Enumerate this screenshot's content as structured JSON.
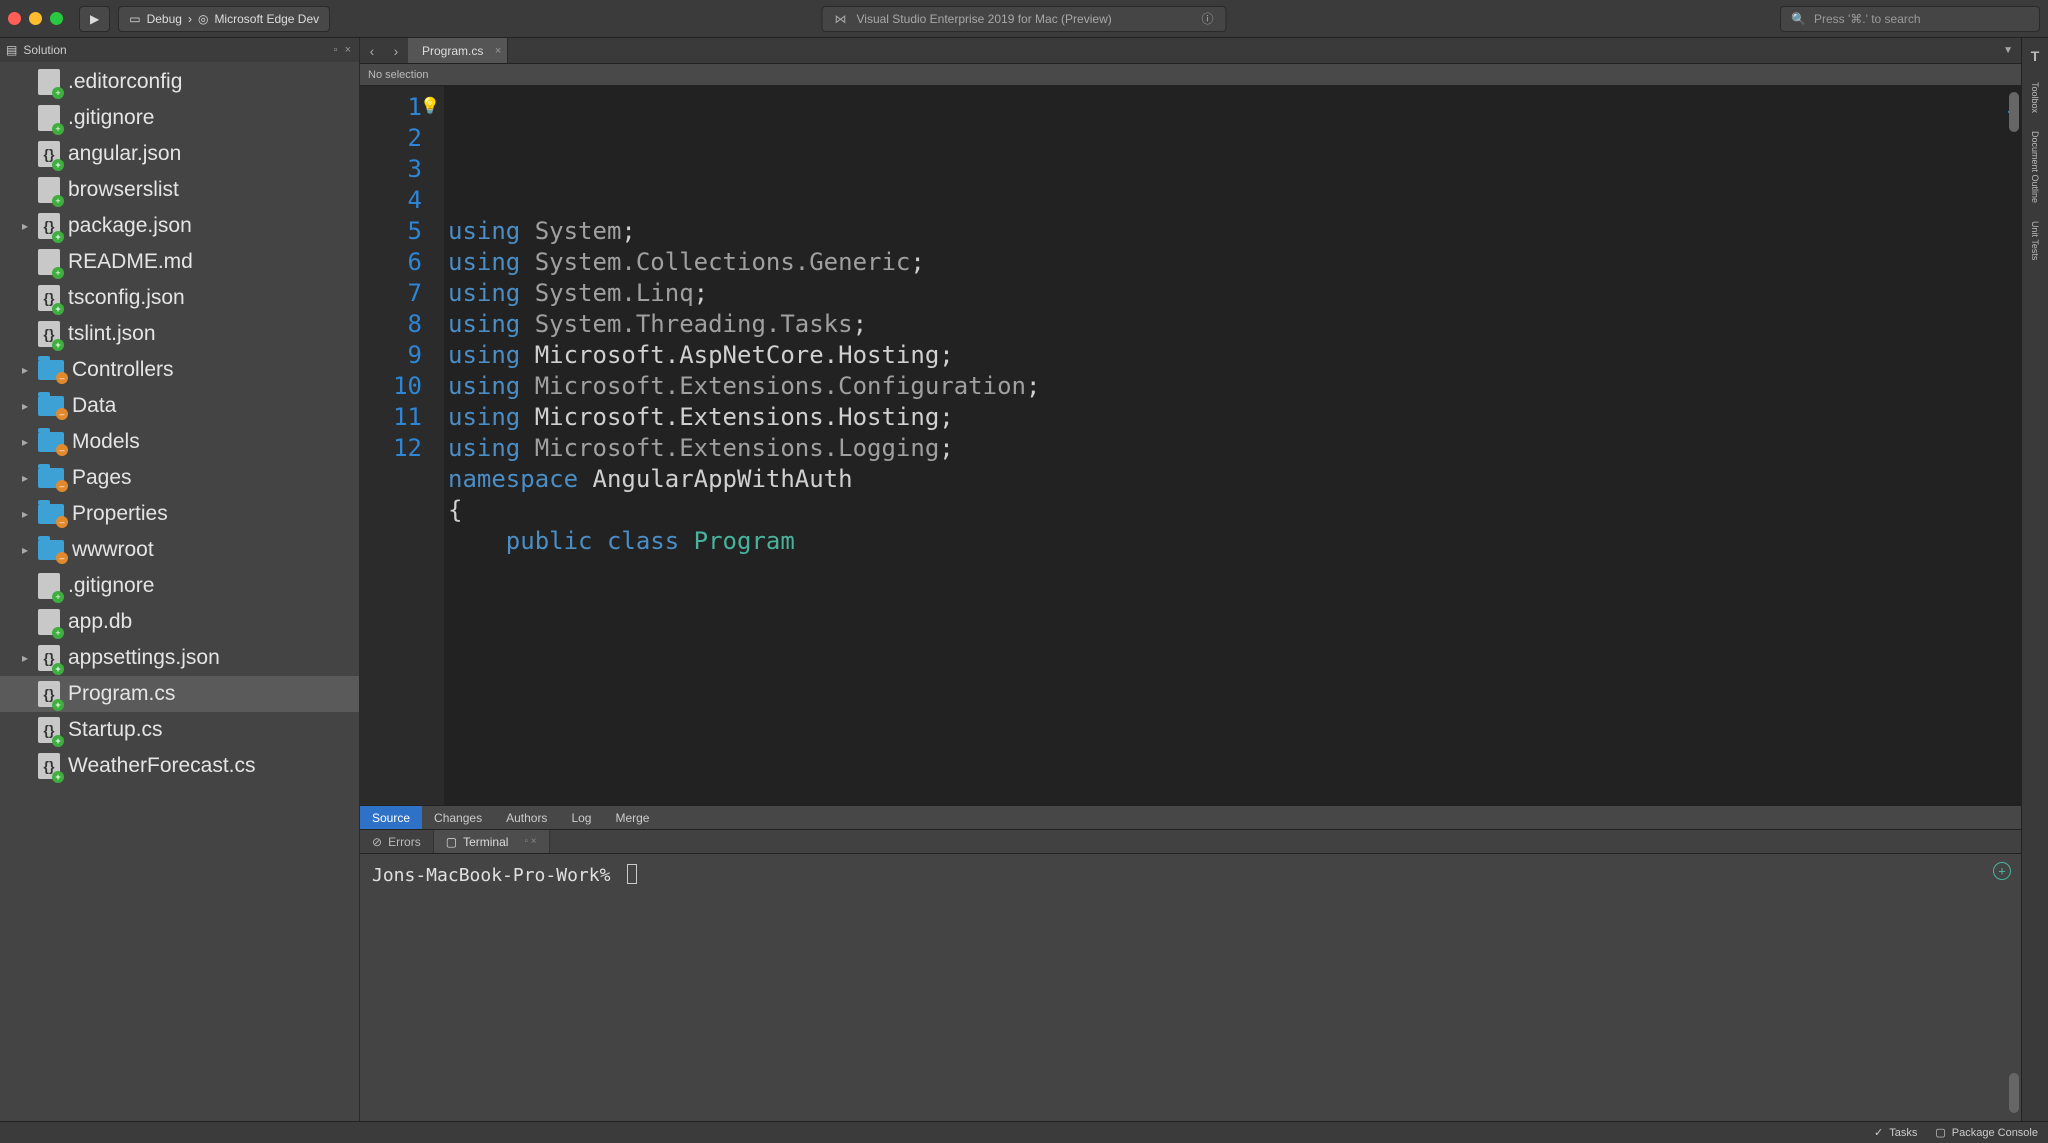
{
  "titlebar": {
    "run_config": "Debug",
    "run_target": "Microsoft Edge Dev",
    "title": "Visual Studio Enterprise 2019 for Mac (Preview)",
    "search_placeholder": "Press '⌘.' to search"
  },
  "solution_panel": {
    "header": "Solution",
    "items": [
      {
        "name": ".editorconfig",
        "icon": "file",
        "badge": "add",
        "expandable": false
      },
      {
        "name": ".gitignore",
        "icon": "file",
        "badge": "add",
        "expandable": false
      },
      {
        "name": "angular.json",
        "icon": "json",
        "badge": "add",
        "expandable": false
      },
      {
        "name": "browserslist",
        "icon": "file",
        "badge": "add",
        "expandable": false
      },
      {
        "name": "package.json",
        "icon": "json",
        "badge": "add",
        "expandable": true
      },
      {
        "name": "README.md",
        "icon": "file",
        "badge": "add",
        "expandable": false
      },
      {
        "name": "tsconfig.json",
        "icon": "json",
        "badge": "add",
        "expandable": false
      },
      {
        "name": "tslint.json",
        "icon": "json",
        "badge": "add",
        "expandable": false
      },
      {
        "name": "Controllers",
        "icon": "folder",
        "badge": "mod",
        "expandable": true
      },
      {
        "name": "Data",
        "icon": "folder",
        "badge": "mod",
        "expandable": true
      },
      {
        "name": "Models",
        "icon": "folder",
        "badge": "mod",
        "expandable": true
      },
      {
        "name": "Pages",
        "icon": "folder",
        "badge": "mod",
        "expandable": true
      },
      {
        "name": "Properties",
        "icon": "folder",
        "badge": "mod",
        "expandable": true
      },
      {
        "name": "wwwroot",
        "icon": "folder",
        "badge": "mod",
        "expandable": true
      },
      {
        "name": ".gitignore",
        "icon": "file",
        "badge": "add",
        "expandable": false
      },
      {
        "name": "app.db",
        "icon": "file",
        "badge": "add",
        "expandable": false
      },
      {
        "name": "appsettings.json",
        "icon": "json",
        "badge": "add",
        "expandable": true
      },
      {
        "name": "Program.cs",
        "icon": "json",
        "badge": "add",
        "expandable": false,
        "selected": true
      },
      {
        "name": "Startup.cs",
        "icon": "json",
        "badge": "add",
        "expandable": false
      },
      {
        "name": "WeatherForecast.cs",
        "icon": "json",
        "badge": "add",
        "expandable": false
      }
    ]
  },
  "editor": {
    "tab_label": "Program.cs",
    "breadcrumb": "No selection",
    "lines": [
      [
        [
          "kw",
          "using"
        ],
        [
          "nsg",
          " System"
        ],
        [
          "ns",
          ";"
        ]
      ],
      [
        [
          "kw",
          "using"
        ],
        [
          "nsg",
          " System.Collections.Generic"
        ],
        [
          "ns",
          ";"
        ]
      ],
      [
        [
          "kw",
          "using"
        ],
        [
          "nsg",
          " System.Linq"
        ],
        [
          "ns",
          ";"
        ]
      ],
      [
        [
          "kw",
          "using"
        ],
        [
          "nsg",
          " System.Threading.Tasks"
        ],
        [
          "ns",
          ";"
        ]
      ],
      [
        [
          "kw",
          "using"
        ],
        [
          "ns",
          " Microsoft.AspNetCore.Hosting;"
        ]
      ],
      [
        [
          "kw",
          "using"
        ],
        [
          "nsg",
          " Microsoft.Extensions.Configuration"
        ],
        [
          "ns",
          ";"
        ]
      ],
      [
        [
          "kw",
          "using"
        ],
        [
          "ns",
          " Microsoft.Extensions.Hosting;"
        ]
      ],
      [
        [
          "kw",
          "using"
        ],
        [
          "nsg",
          " Microsoft.Extensions.Logging"
        ],
        [
          "ns",
          ";"
        ]
      ],
      [
        [
          "ns",
          ""
        ]
      ],
      [
        [
          "kw",
          "namespace"
        ],
        [
          "ns",
          " AngularAppWithAuth"
        ]
      ],
      [
        [
          "ns",
          "{"
        ]
      ],
      [
        [
          "ns",
          "    "
        ],
        [
          "kw",
          "public"
        ],
        [
          "ns",
          " "
        ],
        [
          "kw",
          "class"
        ],
        [
          "ns",
          " "
        ],
        [
          "cls",
          "Program"
        ]
      ]
    ]
  },
  "bottom_tabs": [
    "Source",
    "Changes",
    "Authors",
    "Log",
    "Merge"
  ],
  "panel_pills": [
    {
      "label": "Errors",
      "icon": "⊘",
      "active": false
    },
    {
      "label": "Terminal",
      "icon": "▢",
      "active": true
    }
  ],
  "terminal_prompt": "Jons-MacBook-Pro-Work%",
  "right_rail": [
    "Toolbox",
    "Document Outline",
    "Unit Tests"
  ],
  "statusbar": {
    "tasks": "Tasks",
    "package_console": "Package Console"
  }
}
